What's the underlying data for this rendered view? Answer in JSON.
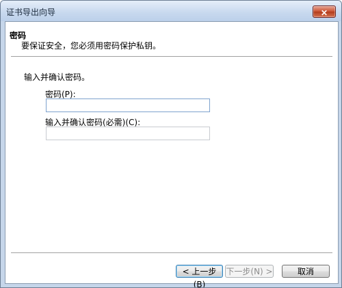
{
  "window": {
    "title": "证书导出向导",
    "close_glyph": "✕"
  },
  "header": {
    "title": "密码",
    "subtitle": "要保证安全，您必须用密码保护私钥。"
  },
  "form": {
    "prompt": "输入并确认密码。",
    "password_label": "密码(P):",
    "password_value": "",
    "confirm_label": "输入并确认密码(必需)(C):",
    "confirm_value": ""
  },
  "buttons": {
    "back": "< 上一步(B)",
    "next": "下一步(N) >",
    "cancel": "取消"
  }
}
